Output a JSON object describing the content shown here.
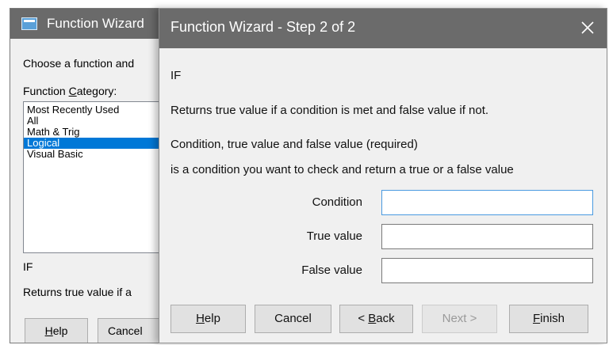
{
  "background_window": {
    "title": "Function Wizard",
    "prompt": "Choose a function and",
    "category_label": "Function Category:",
    "categories": [
      {
        "label": "Most Recently Used",
        "selected": false
      },
      {
        "label": "All",
        "selected": false
      },
      {
        "label": "Math & Trig",
        "selected": false
      },
      {
        "label": "Logical",
        "selected": true
      },
      {
        "label": "Visual Basic",
        "selected": false
      }
    ],
    "function_name": "IF",
    "function_desc": "Returns true value if a",
    "help_label": "Help",
    "cancel_label": "Cancel"
  },
  "dialog": {
    "title": "Function Wizard - Step 2 of 2",
    "function_name": "IF",
    "function_desc": "Returns true value if a condition is met and false value if not.",
    "args_heading": "Condition, true value and false value (required)",
    "arg_desc": "is a condition you want to check and return a true or a false value",
    "fields": [
      {
        "label": "Condition",
        "value": ""
      },
      {
        "label": "True value",
        "value": ""
      },
      {
        "label": "False value",
        "value": ""
      }
    ],
    "buttons": {
      "help": "Help",
      "cancel": "Cancel",
      "back": "< Back",
      "next": "Next >",
      "finish": "Finish"
    }
  },
  "colors": {
    "titlebar": "#6b6b6b",
    "selection": "#0078d7",
    "focus_border": "#4a9ae0"
  }
}
